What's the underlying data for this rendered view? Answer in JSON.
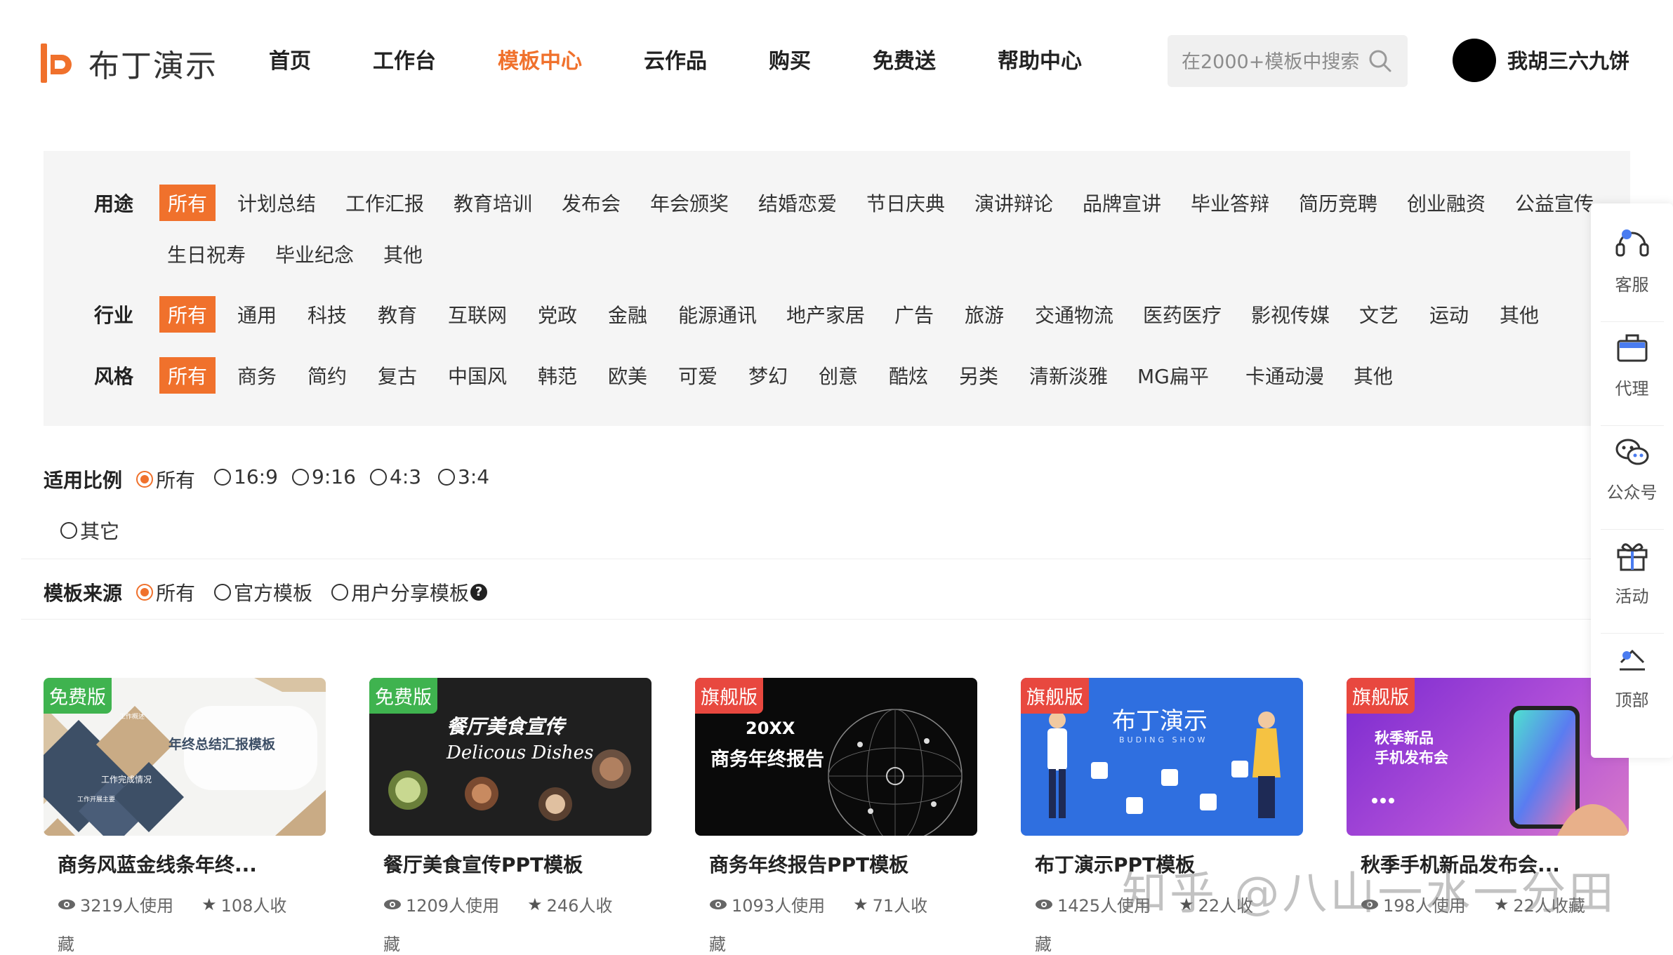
{
  "header": {
    "logo_text": "布丁演示",
    "nav": [
      "首页",
      "工作台",
      "模板中心",
      "云作品",
      "购买",
      "免费送",
      "帮助中心"
    ],
    "active_nav": "模板中心",
    "search_placeholder": "在2000+模板中搜索",
    "username": "我胡三六九饼"
  },
  "filters": {
    "usage": {
      "label": "用途",
      "options": [
        "所有",
        "计划总结",
        "工作汇报",
        "教育培训",
        "发布会",
        "年会颁奖",
        "结婚恋爱",
        "节日庆典",
        "演讲辩论",
        "品牌宣讲",
        "毕业答辩",
        "简历竞聘",
        "创业融资",
        "公益宣传",
        "生日祝寿",
        "毕业纪念",
        "其他"
      ],
      "selected": "所有"
    },
    "industry": {
      "label": "行业",
      "options": [
        "所有",
        "通用",
        "科技",
        "教育",
        "互联网",
        "党政",
        "金融",
        "能源通讯",
        "地产家居",
        "广告",
        "旅游",
        "交通物流",
        "医药医疗",
        "影视传媒",
        "文艺",
        "运动",
        "其他"
      ],
      "selected": "所有"
    },
    "style": {
      "label": "风格",
      "options": [
        "所有",
        "商务",
        "简约",
        "复古",
        "中国风",
        "韩范",
        "欧美",
        "可爱",
        "梦幻",
        "创意",
        "酷炫",
        "另类",
        "清新淡雅",
        "MG扁平",
        "卡通动漫",
        "其他"
      ],
      "selected": "所有"
    }
  },
  "ratio": {
    "label": "适用比例",
    "options": [
      "所有",
      "16:9",
      "9:16",
      "4:3",
      "3:4",
      "其它"
    ],
    "selected": "所有"
  },
  "source": {
    "label": "模板来源",
    "options": [
      "所有",
      "官方模板",
      "用户分享模板"
    ],
    "selected": "所有",
    "help_icon": "question-circle-icon"
  },
  "cards": [
    {
      "badge": "免费版",
      "badge_type": "free",
      "title": "商务风蓝金线条年终...",
      "uses": "3219人使用",
      "favs": "108人收",
      "extra": "藏",
      "thumb": {
        "line1": "年终总结汇报模板",
        "line2": "工作完成情况",
        "line3": "工作概述",
        "line4": "工作开展主要"
      }
    },
    {
      "badge": "免费版",
      "badge_type": "free",
      "title": "餐厅美食宣传PPT模板",
      "uses": "1209人使用",
      "favs": "246人收",
      "extra": "藏",
      "thumb": {
        "line1": "餐厅美食宣传",
        "line2": "Delicous Dishes"
      }
    },
    {
      "badge": "旗舰版",
      "badge_type": "pro",
      "title": "商务年终报告PPT模板",
      "uses": "1093人使用",
      "favs": "71人收",
      "extra": "藏",
      "thumb": {
        "line1": "20XX",
        "line2": "商务年终报告"
      }
    },
    {
      "badge": "旗舰版",
      "badge_type": "pro",
      "title": "布丁演示PPT模板",
      "uses": "1425人使用",
      "favs": "22人收",
      "extra": "藏",
      "thumb": {
        "line1": "布丁演示",
        "line2": "BUDING SHOW"
      }
    },
    {
      "badge": "旗舰版",
      "badge_type": "pro",
      "title": "秋季手机新品发布会...",
      "uses": "198人使用",
      "favs": "22人收藏",
      "extra": "",
      "thumb": {
        "line1": "秋季新品",
        "line2": "手机发布会"
      }
    }
  ],
  "side": [
    "客服",
    "代理",
    "公众号",
    "活动",
    "顶部"
  ],
  "watermark": "知乎 @八山一水一分田",
  "colors": {
    "accent": "#f0712c",
    "free_badge": "#3fb34f",
    "pro_badge": "#e8483f"
  }
}
